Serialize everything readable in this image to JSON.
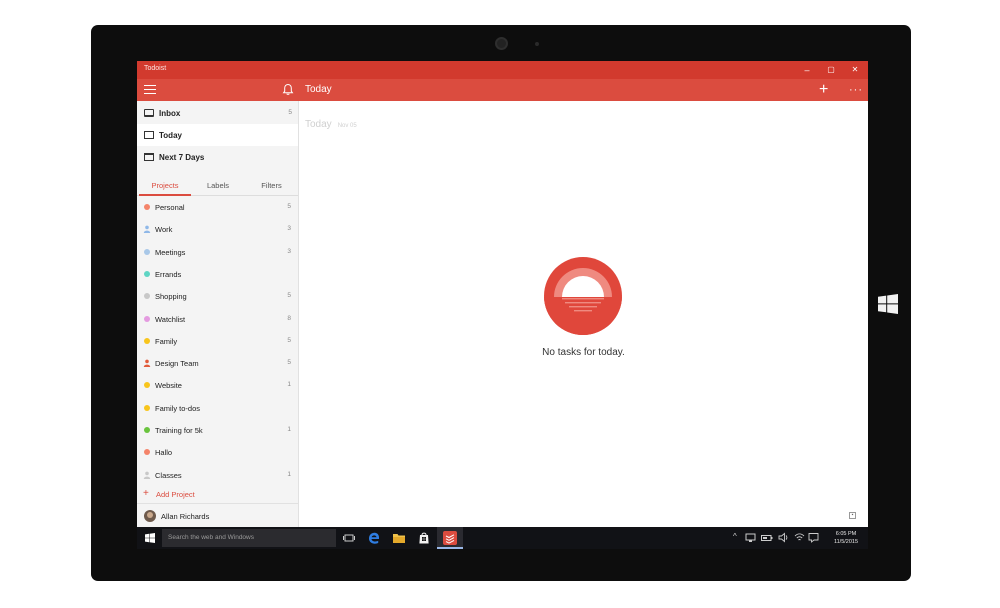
{
  "app": {
    "title": "Todoist",
    "toolbar_title": "Today",
    "window_controls": {
      "minimize": "–",
      "restore": "▢",
      "close": "✕"
    },
    "accent_color": "#db4c3f"
  },
  "nav": [
    {
      "label": "Inbox",
      "count": "5",
      "icon": "inbox-icon"
    },
    {
      "label": "Today",
      "count": "",
      "icon": "calendar-today-icon"
    },
    {
      "label": "Next 7 Days",
      "count": "",
      "icon": "calendar-week-icon"
    }
  ],
  "tabs": [
    {
      "label": "Projects",
      "active": true
    },
    {
      "label": "Labels",
      "active": false
    },
    {
      "label": "Filters",
      "active": false
    }
  ],
  "projects": [
    {
      "label": "Personal",
      "count": "5",
      "color": "#f4846a",
      "shared": false
    },
    {
      "label": "Work",
      "count": "3",
      "color": "#8fb8e8",
      "shared": true
    },
    {
      "label": "Meetings",
      "count": "3",
      "color": "#a9c8e8",
      "shared": false
    },
    {
      "label": "Errands",
      "count": "",
      "color": "#5fd5c4",
      "shared": false
    },
    {
      "label": "Shopping",
      "count": "5",
      "color": "#c8c8c8",
      "shared": false
    },
    {
      "label": "Watchlist",
      "count": "8",
      "color": "#e49be0",
      "shared": false
    },
    {
      "label": "Family",
      "count": "5",
      "color": "#f8c51c",
      "shared": false
    },
    {
      "label": "Design Team",
      "count": "5",
      "color": "#e25b3a",
      "shared": true
    },
    {
      "label": "Website",
      "count": "1",
      "color": "#f8c51c",
      "shared": false
    },
    {
      "label": "Family to-dos",
      "count": "",
      "color": "#f8c51c",
      "shared": false
    },
    {
      "label": "Training for 5k",
      "count": "1",
      "color": "#6ac43e",
      "shared": false
    },
    {
      "label": "Hallo",
      "count": "",
      "color": "#f4846a",
      "shared": false
    },
    {
      "label": "Classes",
      "count": "1",
      "color": "#c8c8c8",
      "shared": true
    }
  ],
  "add_project_label": "Add Project",
  "user": {
    "name": "Allan Richards"
  },
  "main": {
    "header_title": "Today",
    "header_date": "Nov 05",
    "empty_message": "No tasks for today."
  },
  "taskbar": {
    "search_placeholder": "Search the web and Windows",
    "tray_icons": [
      "chevron-up-icon",
      "network-icon",
      "battery-icon",
      "volume-icon",
      "wifi-icon",
      "action-center-icon",
      "keyboard-icon"
    ],
    "time": "6:05 PM",
    "date": "11/5/2015"
  }
}
